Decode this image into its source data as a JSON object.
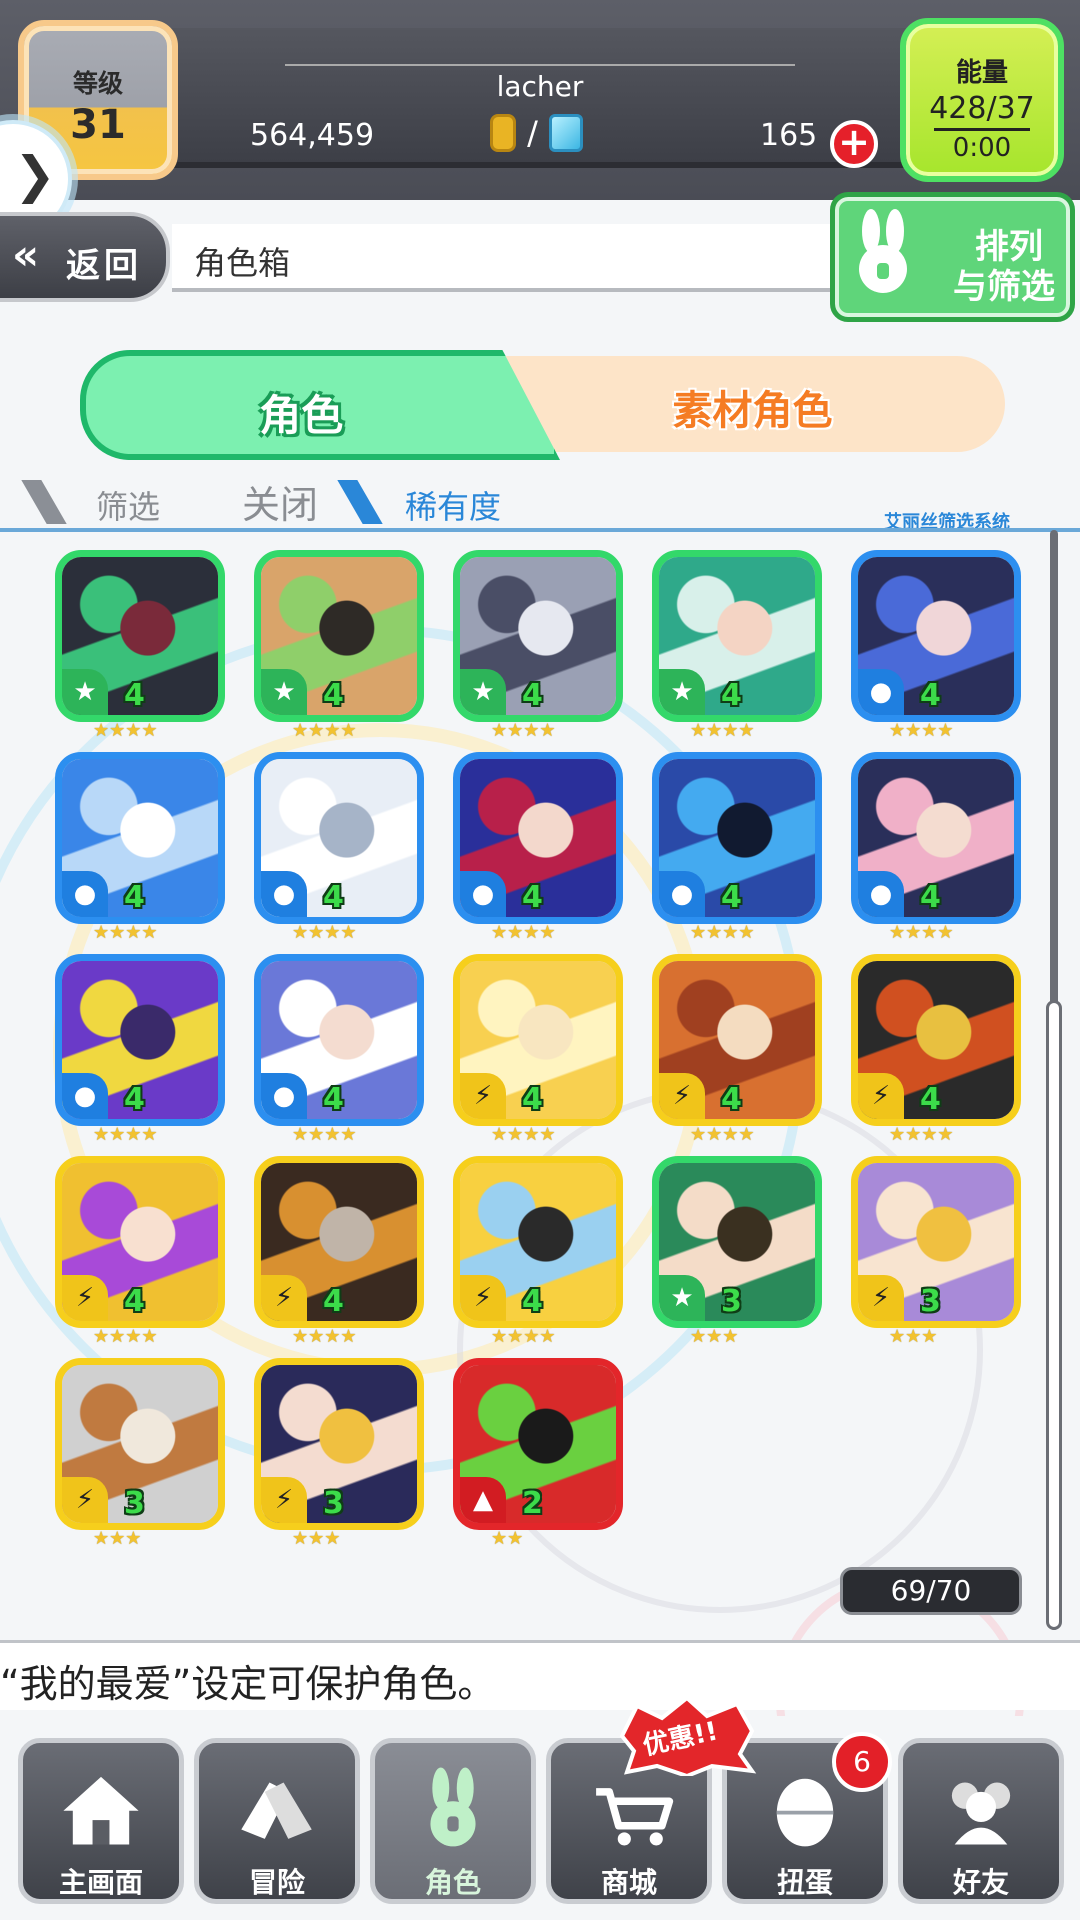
{
  "status": {
    "rank_label": "等级",
    "rank_value": "31",
    "player_name": "lacher",
    "coins": "564,459",
    "currency_separator": "/",
    "gems": "165",
    "energy_label": "能量",
    "energy_value": "428/37",
    "energy_timer": "0:00"
  },
  "header": {
    "back_label": "返回",
    "title": "角色箱",
    "sort_line1": "排列",
    "sort_line2": "与筛选"
  },
  "tabs": {
    "characters": "角色",
    "materials": "素材角色"
  },
  "filter": {
    "label": "筛选",
    "state": "关闭",
    "value": "稀有度",
    "system_name": "艾丽丝筛选系统"
  },
  "characters": [
    {
      "element": "wind",
      "element_icon": "wind-icon",
      "level": "4",
      "stars": 4,
      "palette": [
        "#2b2f3a",
        "#7a2a3a",
        "#3ac07a"
      ]
    },
    {
      "element": "wind",
      "element_icon": "wind-icon",
      "level": "4",
      "stars": 4,
      "palette": [
        "#d9a46a",
        "#2e2a26",
        "#8fcf6a"
      ]
    },
    {
      "element": "wind",
      "element_icon": "wind-icon",
      "level": "4",
      "stars": 4,
      "palette": [
        "#9aa0b4",
        "#e6e8f0",
        "#4a4e66"
      ]
    },
    {
      "element": "wind",
      "element_icon": "wind-icon",
      "level": "4",
      "stars": 4,
      "palette": [
        "#2fa98a",
        "#f4d4c4",
        "#d8f0ea"
      ]
    },
    {
      "element": "water",
      "element_icon": "water-icon",
      "level": "4",
      "stars": 4,
      "palette": [
        "#2a2f5a",
        "#f0d6d8",
        "#4a6ad8"
      ]
    },
    {
      "element": "water",
      "element_icon": "water-icon",
      "level": "4",
      "stars": 4,
      "palette": [
        "#3a86e8",
        "#ffffff",
        "#b8d8f8"
      ]
    },
    {
      "element": "water",
      "element_icon": "water-icon",
      "level": "4",
      "stars": 4,
      "palette": [
        "#e8eef6",
        "#a6b4c8",
        "#ffffff"
      ]
    },
    {
      "element": "water",
      "element_icon": "water-icon",
      "level": "4",
      "stars": 4,
      "palette": [
        "#2a2f9a",
        "#f3d8cc",
        "#b8204a"
      ]
    },
    {
      "element": "water",
      "element_icon": "water-icon",
      "level": "4",
      "stars": 4,
      "palette": [
        "#2a4aa8",
        "#111a30",
        "#44aaf0"
      ]
    },
    {
      "element": "water",
      "element_icon": "water-icon",
      "level": "4",
      "stars": 4,
      "palette": [
        "#2a2f5a",
        "#f4dcd0",
        "#f0b0c8"
      ]
    },
    {
      "element": "water",
      "element_icon": "water-icon",
      "level": "4",
      "stars": 4,
      "palette": [
        "#6a3ac8",
        "#3a2a6a",
        "#f0d840"
      ]
    },
    {
      "element": "water",
      "element_icon": "water-icon",
      "level": "4",
      "stars": 4,
      "palette": [
        "#6a78d8",
        "#f4dcd0",
        "#ffffff"
      ]
    },
    {
      "element": "thunder",
      "element_icon": "thunder-icon",
      "level": "4",
      "stars": 4,
      "palette": [
        "#f8d050",
        "#f8e6c0",
        "#fff4c0"
      ]
    },
    {
      "element": "thunder",
      "element_icon": "thunder-icon",
      "level": "4",
      "stars": 4,
      "palette": [
        "#d87030",
        "#f4dcc0",
        "#a04020"
      ]
    },
    {
      "element": "thunder",
      "element_icon": "thunder-icon",
      "level": "4",
      "stars": 4,
      "palette": [
        "#2a2a2a",
        "#e8c040",
        "#d05020"
      ]
    },
    {
      "element": "thunder",
      "element_icon": "thunder-icon",
      "level": "4",
      "stars": 4,
      "palette": [
        "#f0c030",
        "#f8e0d0",
        "#a84ad8"
      ]
    },
    {
      "element": "thunder",
      "element_icon": "thunder-icon",
      "level": "4",
      "stars": 4,
      "palette": [
        "#3a2a20",
        "#c0b4a8",
        "#d89030"
      ]
    },
    {
      "element": "thunder",
      "element_icon": "thunder-icon",
      "level": "4",
      "stars": 4,
      "palette": [
        "#f8d040",
        "#2a2a2a",
        "#9ad0f0"
      ]
    },
    {
      "element": "wind",
      "element_icon": "wind-icon",
      "level": "3",
      "stars": 3,
      "palette": [
        "#2a8a5a",
        "#3a3020",
        "#f4dcc8"
      ]
    },
    {
      "element": "thunder",
      "element_icon": "thunder-icon",
      "level": "3",
      "stars": 3,
      "palette": [
        "#a88ad8",
        "#f0c040",
        "#f8e4d0"
      ]
    },
    {
      "element": "thunder",
      "element_icon": "thunder-icon",
      "level": "3",
      "stars": 3,
      "palette": [
        "#d0d0d0",
        "#f0e8dc",
        "#c07a40"
      ]
    },
    {
      "element": "thunder",
      "element_icon": "thunder-icon",
      "level": "3",
      "stars": 3,
      "palette": [
        "#2a2a5a",
        "#f0c040",
        "#f4dcd0"
      ]
    },
    {
      "element": "fire",
      "element_icon": "fire-icon",
      "level": "2",
      "stars": 2,
      "palette": [
        "#d82a2a",
        "#1a1a1a",
        "#6ad040"
      ]
    }
  ],
  "box_count": "69/70",
  "hint": "“我的最爱”设定可保护角色。",
  "promo_label": "优惠!!",
  "gacha_badge": "6",
  "nav": {
    "home": "主画面",
    "adventure": "冒险",
    "characters": "角色",
    "shop": "商城",
    "gacha": "扭蛋",
    "friends": "好友"
  },
  "colors": {
    "accent_green": "#1fb86a",
    "accent_orange": "#f57c23",
    "accent_blue": "#2a87d8",
    "wind": "#33d86a",
    "water": "#2c8ff0",
    "thunder": "#f6cf1c",
    "fire": "#e3262a"
  }
}
